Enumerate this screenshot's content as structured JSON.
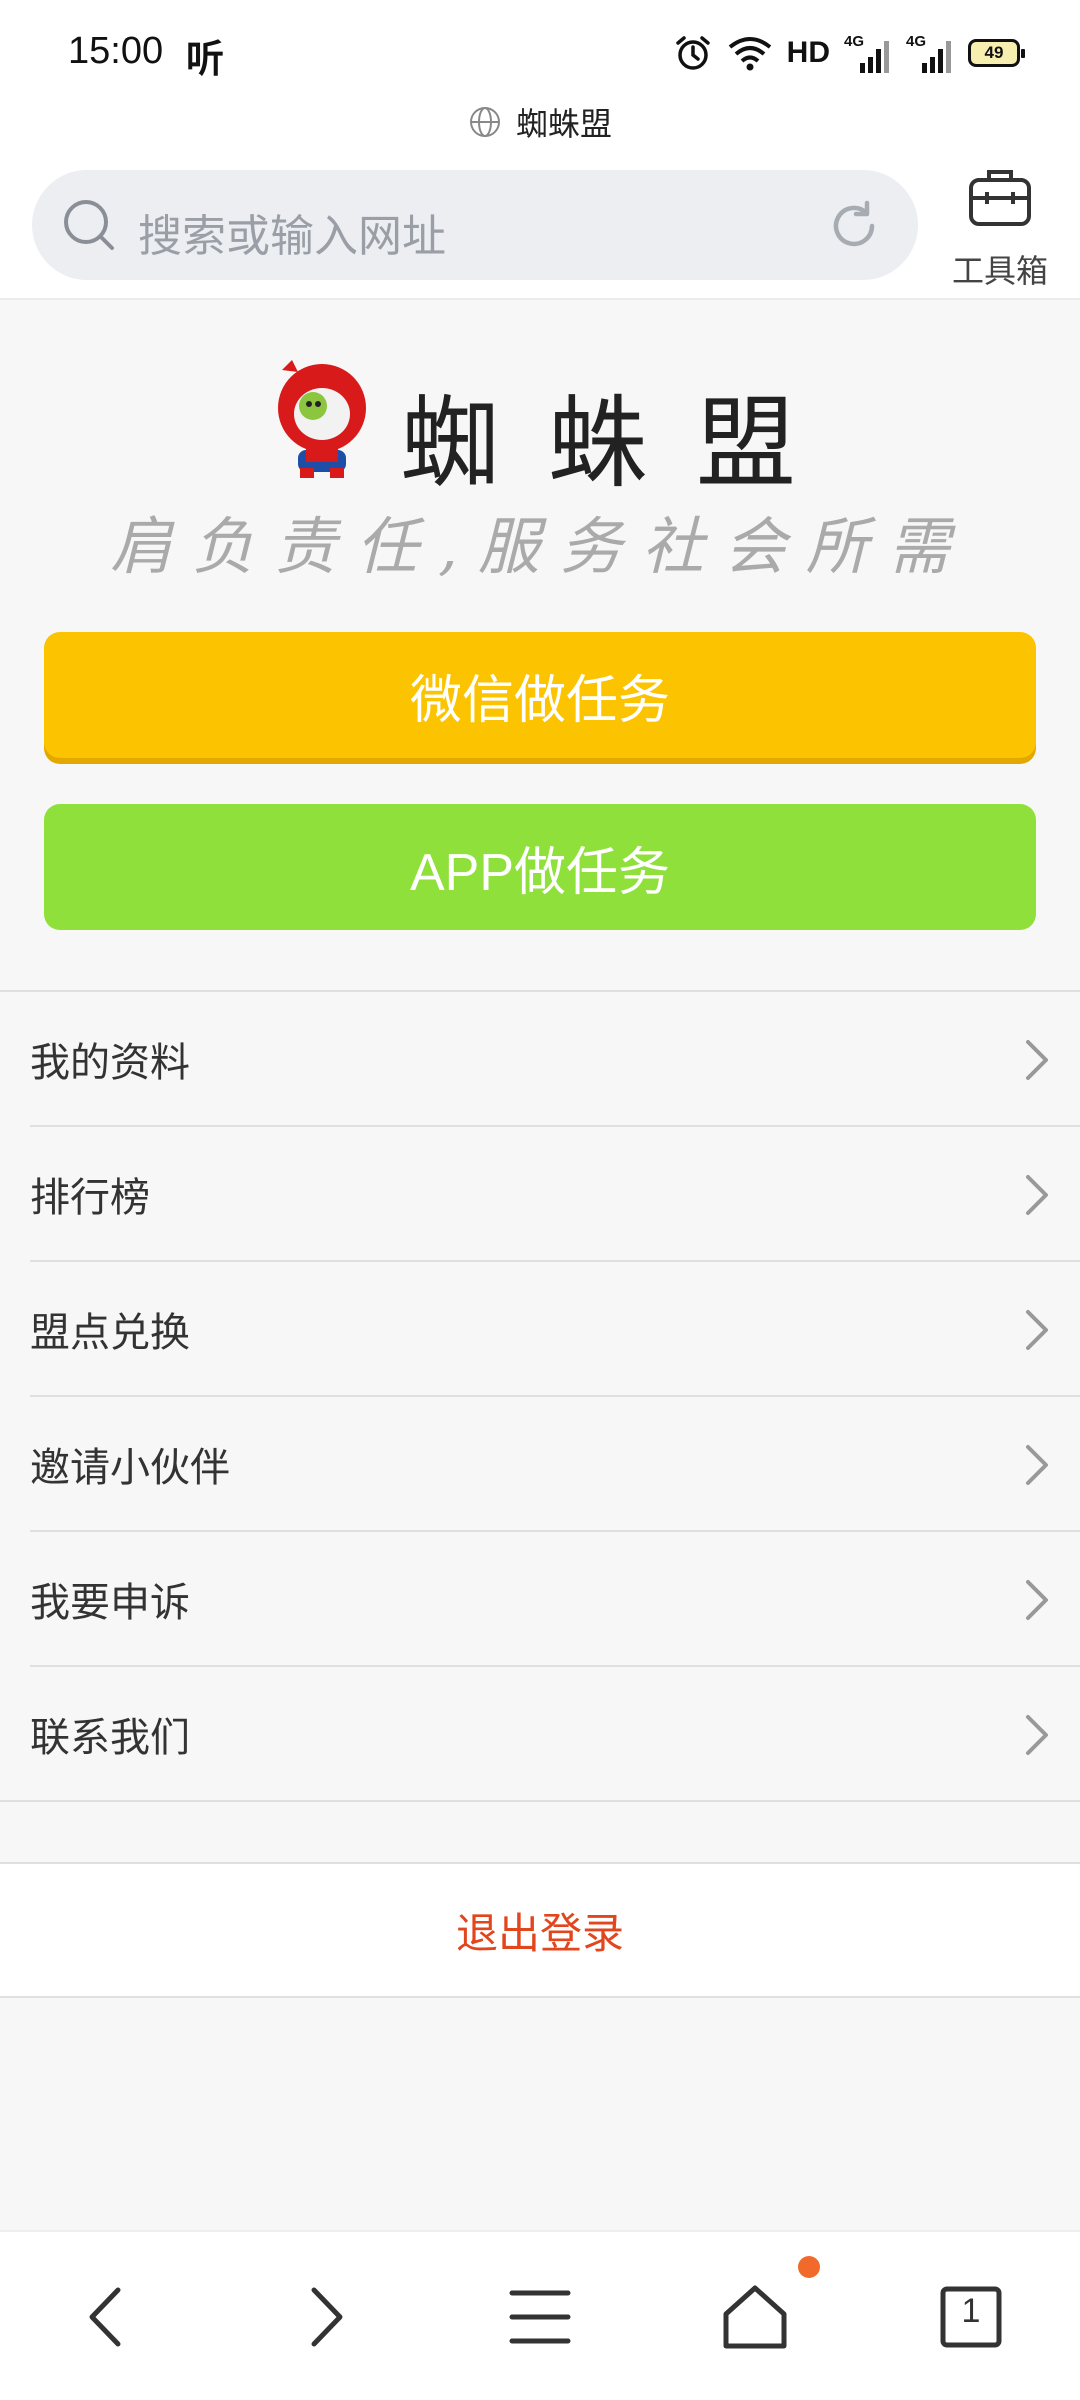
{
  "status_bar": {
    "time": "15:00",
    "voice_icon_text": "听",
    "network": "HD",
    "signal1_label": "4G",
    "signal2_label": "4G",
    "battery": "49"
  },
  "browser": {
    "page_title": "蜘蛛盟",
    "search_placeholder": "搜索或输入网址",
    "toolbox_label": "工具箱"
  },
  "hero": {
    "logo_text": "蜘蛛盟",
    "slogan": "肩负责任,服务社会所需",
    "wechat_button": "微信做任务",
    "app_button": "APP做任务",
    "colors": {
      "wechat": "#fcc300",
      "app": "#8fe03a"
    }
  },
  "menu": {
    "items": [
      {
        "label": "我的资料"
      },
      {
        "label": "排行榜"
      },
      {
        "label": "盟点兑换"
      },
      {
        "label": "邀请小伙伴"
      },
      {
        "label": "我要申诉"
      },
      {
        "label": "联系我们"
      }
    ]
  },
  "logout": {
    "label": "退出登录",
    "color": "#e2461d"
  },
  "bottom_nav": {
    "tab_count": "1",
    "icons": [
      "back-icon",
      "forward-icon",
      "menu-icon",
      "home-icon",
      "tabs-icon"
    ]
  }
}
